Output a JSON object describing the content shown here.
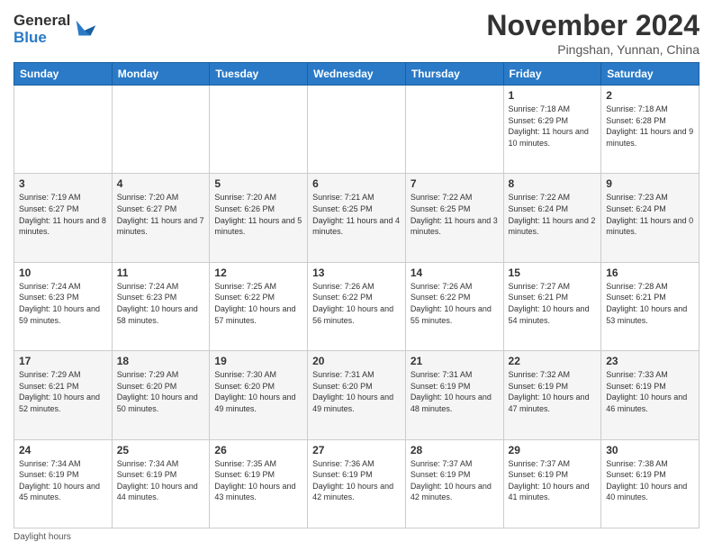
{
  "logo": {
    "line1": "General",
    "line2": "Blue"
  },
  "header": {
    "month": "November 2024",
    "location": "Pingshan, Yunnan, China"
  },
  "weekdays": [
    "Sunday",
    "Monday",
    "Tuesday",
    "Wednesday",
    "Thursday",
    "Friday",
    "Saturday"
  ],
  "weeks": [
    [
      {
        "day": "",
        "info": ""
      },
      {
        "day": "",
        "info": ""
      },
      {
        "day": "",
        "info": ""
      },
      {
        "day": "",
        "info": ""
      },
      {
        "day": "",
        "info": ""
      },
      {
        "day": "1",
        "info": "Sunrise: 7:18 AM\nSunset: 6:29 PM\nDaylight: 11 hours and 10 minutes."
      },
      {
        "day": "2",
        "info": "Sunrise: 7:18 AM\nSunset: 6:28 PM\nDaylight: 11 hours and 9 minutes."
      }
    ],
    [
      {
        "day": "3",
        "info": "Sunrise: 7:19 AM\nSunset: 6:27 PM\nDaylight: 11 hours and 8 minutes."
      },
      {
        "day": "4",
        "info": "Sunrise: 7:20 AM\nSunset: 6:27 PM\nDaylight: 11 hours and 7 minutes."
      },
      {
        "day": "5",
        "info": "Sunrise: 7:20 AM\nSunset: 6:26 PM\nDaylight: 11 hours and 5 minutes."
      },
      {
        "day": "6",
        "info": "Sunrise: 7:21 AM\nSunset: 6:25 PM\nDaylight: 11 hours and 4 minutes."
      },
      {
        "day": "7",
        "info": "Sunrise: 7:22 AM\nSunset: 6:25 PM\nDaylight: 11 hours and 3 minutes."
      },
      {
        "day": "8",
        "info": "Sunrise: 7:22 AM\nSunset: 6:24 PM\nDaylight: 11 hours and 2 minutes."
      },
      {
        "day": "9",
        "info": "Sunrise: 7:23 AM\nSunset: 6:24 PM\nDaylight: 11 hours and 0 minutes."
      }
    ],
    [
      {
        "day": "10",
        "info": "Sunrise: 7:24 AM\nSunset: 6:23 PM\nDaylight: 10 hours and 59 minutes."
      },
      {
        "day": "11",
        "info": "Sunrise: 7:24 AM\nSunset: 6:23 PM\nDaylight: 10 hours and 58 minutes."
      },
      {
        "day": "12",
        "info": "Sunrise: 7:25 AM\nSunset: 6:22 PM\nDaylight: 10 hours and 57 minutes."
      },
      {
        "day": "13",
        "info": "Sunrise: 7:26 AM\nSunset: 6:22 PM\nDaylight: 10 hours and 56 minutes."
      },
      {
        "day": "14",
        "info": "Sunrise: 7:26 AM\nSunset: 6:22 PM\nDaylight: 10 hours and 55 minutes."
      },
      {
        "day": "15",
        "info": "Sunrise: 7:27 AM\nSunset: 6:21 PM\nDaylight: 10 hours and 54 minutes."
      },
      {
        "day": "16",
        "info": "Sunrise: 7:28 AM\nSunset: 6:21 PM\nDaylight: 10 hours and 53 minutes."
      }
    ],
    [
      {
        "day": "17",
        "info": "Sunrise: 7:29 AM\nSunset: 6:21 PM\nDaylight: 10 hours and 52 minutes."
      },
      {
        "day": "18",
        "info": "Sunrise: 7:29 AM\nSunset: 6:20 PM\nDaylight: 10 hours and 50 minutes."
      },
      {
        "day": "19",
        "info": "Sunrise: 7:30 AM\nSunset: 6:20 PM\nDaylight: 10 hours and 49 minutes."
      },
      {
        "day": "20",
        "info": "Sunrise: 7:31 AM\nSunset: 6:20 PM\nDaylight: 10 hours and 49 minutes."
      },
      {
        "day": "21",
        "info": "Sunrise: 7:31 AM\nSunset: 6:19 PM\nDaylight: 10 hours and 48 minutes."
      },
      {
        "day": "22",
        "info": "Sunrise: 7:32 AM\nSunset: 6:19 PM\nDaylight: 10 hours and 47 minutes."
      },
      {
        "day": "23",
        "info": "Sunrise: 7:33 AM\nSunset: 6:19 PM\nDaylight: 10 hours and 46 minutes."
      }
    ],
    [
      {
        "day": "24",
        "info": "Sunrise: 7:34 AM\nSunset: 6:19 PM\nDaylight: 10 hours and 45 minutes."
      },
      {
        "day": "25",
        "info": "Sunrise: 7:34 AM\nSunset: 6:19 PM\nDaylight: 10 hours and 44 minutes."
      },
      {
        "day": "26",
        "info": "Sunrise: 7:35 AM\nSunset: 6:19 PM\nDaylight: 10 hours and 43 minutes."
      },
      {
        "day": "27",
        "info": "Sunrise: 7:36 AM\nSunset: 6:19 PM\nDaylight: 10 hours and 42 minutes."
      },
      {
        "day": "28",
        "info": "Sunrise: 7:37 AM\nSunset: 6:19 PM\nDaylight: 10 hours and 42 minutes."
      },
      {
        "day": "29",
        "info": "Sunrise: 7:37 AM\nSunset: 6:19 PM\nDaylight: 10 hours and 41 minutes."
      },
      {
        "day": "30",
        "info": "Sunrise: 7:38 AM\nSunset: 6:19 PM\nDaylight: 10 hours and 40 minutes."
      }
    ]
  ],
  "footer": {
    "daylight_label": "Daylight hours"
  }
}
